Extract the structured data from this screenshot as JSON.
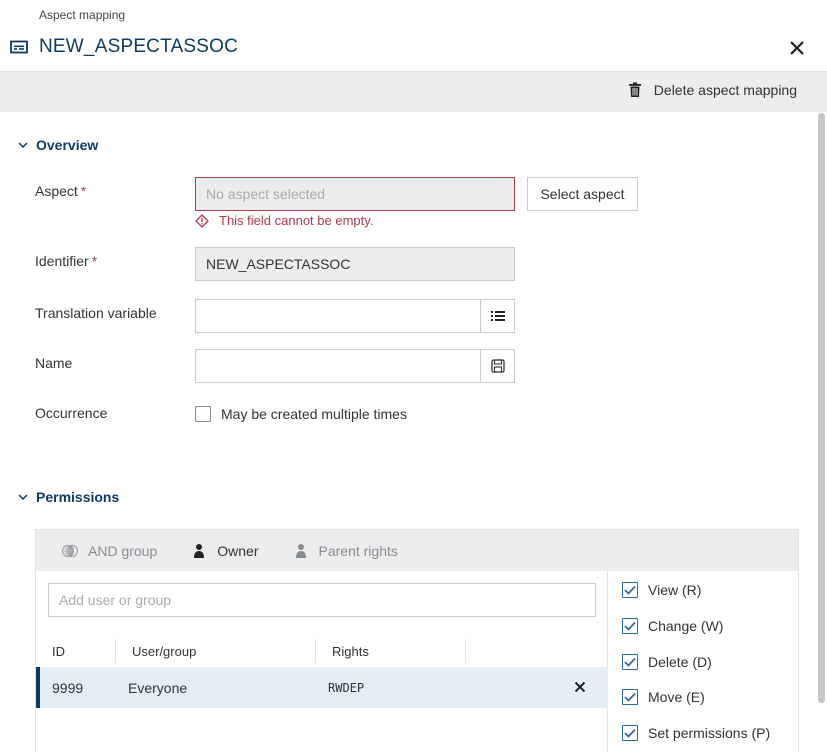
{
  "header": {
    "breadcrumb": "Aspect mapping",
    "title": "NEW_ASPECTASSOC",
    "title_icon": "card-icon",
    "close_icon": "close-icon"
  },
  "toolbar": {
    "delete_label": "Delete aspect mapping",
    "delete_icon": "trash-icon"
  },
  "overview": {
    "heading": "Overview",
    "fields": {
      "aspect": {
        "label": "Aspect",
        "required_marker": "*",
        "placeholder": "No aspect selected",
        "value": "",
        "error": "This field cannot be empty.",
        "button_label": "Select aspect"
      },
      "identifier": {
        "label": "Identifier",
        "required_marker": "*",
        "value": "NEW_ASPECTASSOC"
      },
      "translation_variable": {
        "label": "Translation variable",
        "value": "",
        "addon_icon": "list-icon"
      },
      "name": {
        "label": "Name",
        "value": "",
        "addon_icon": "save-icon"
      },
      "occurrence": {
        "label": "Occurrence",
        "checkbox_label": "May be created multiple times",
        "checked": false
      }
    }
  },
  "permissions": {
    "heading": "Permissions",
    "tabs": [
      {
        "label": "AND group",
        "icon": "and-group-icon",
        "state": "disabled"
      },
      {
        "label": "Owner",
        "icon": "user-icon",
        "state": "active"
      },
      {
        "label": "Parent rights",
        "icon": "user-icon",
        "state": "disabled"
      }
    ],
    "add_placeholder": "Add user or group",
    "columns": [
      "ID",
      "User/group",
      "Rights",
      ""
    ],
    "rows": [
      {
        "id": "9999",
        "user_group": "Everyone",
        "rights": "RWDEP",
        "selected": true
      }
    ],
    "rights": [
      {
        "label": "View (R)",
        "checked": true
      },
      {
        "label": "Change (W)",
        "checked": true
      },
      {
        "label": "Delete (D)",
        "checked": true
      },
      {
        "label": "Move (E)",
        "checked": true
      },
      {
        "label": "Set permissions (P)",
        "checked": true
      }
    ]
  },
  "colors": {
    "accent": "#0d3b66",
    "error": "#b03a4a",
    "toolbar_bg": "#ebedef",
    "selected_row_bg": "#e3eef6",
    "checkbox_blue": "#2c6aa6"
  }
}
